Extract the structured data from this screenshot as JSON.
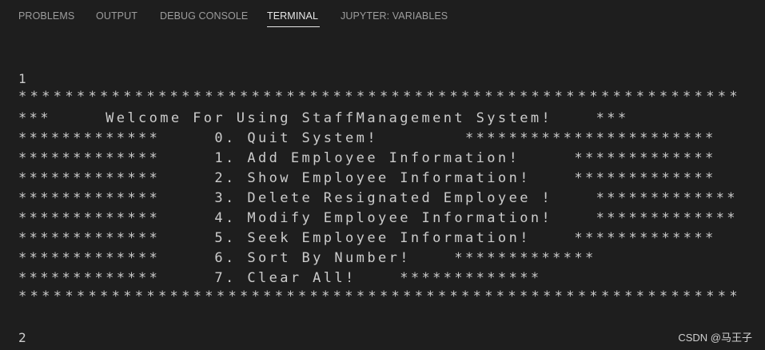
{
  "tabs": [
    {
      "label": "PROBLEMS"
    },
    {
      "label": "OUTPUT"
    },
    {
      "label": "DEBUG CONSOLE"
    },
    {
      "label": "TERMINAL"
    },
    {
      "label": "JUPYTER: VARIABLES"
    }
  ],
  "terminal": {
    "lines": [
      "1",
      "**************************************************************",
      "***     Welcome For Using StaffManagement System!    ***",
      "*************     0. Quit System!        ***********************",
      "*************     1. Add Employee Information!     *************",
      "*************     2. Show Employee Information!    *************",
      "*************     3. Delete Resignated Employee !    *************",
      "*************     4. Modify Employee Information!    *************",
      "*************     5. Seek Employee Information!    *************",
      "*************     6. Sort By Number!    *************",
      "*************     7. Clear All!    *************",
      "**************************************************************",
      "2"
    ]
  },
  "watermark": "CSDN @马王子"
}
